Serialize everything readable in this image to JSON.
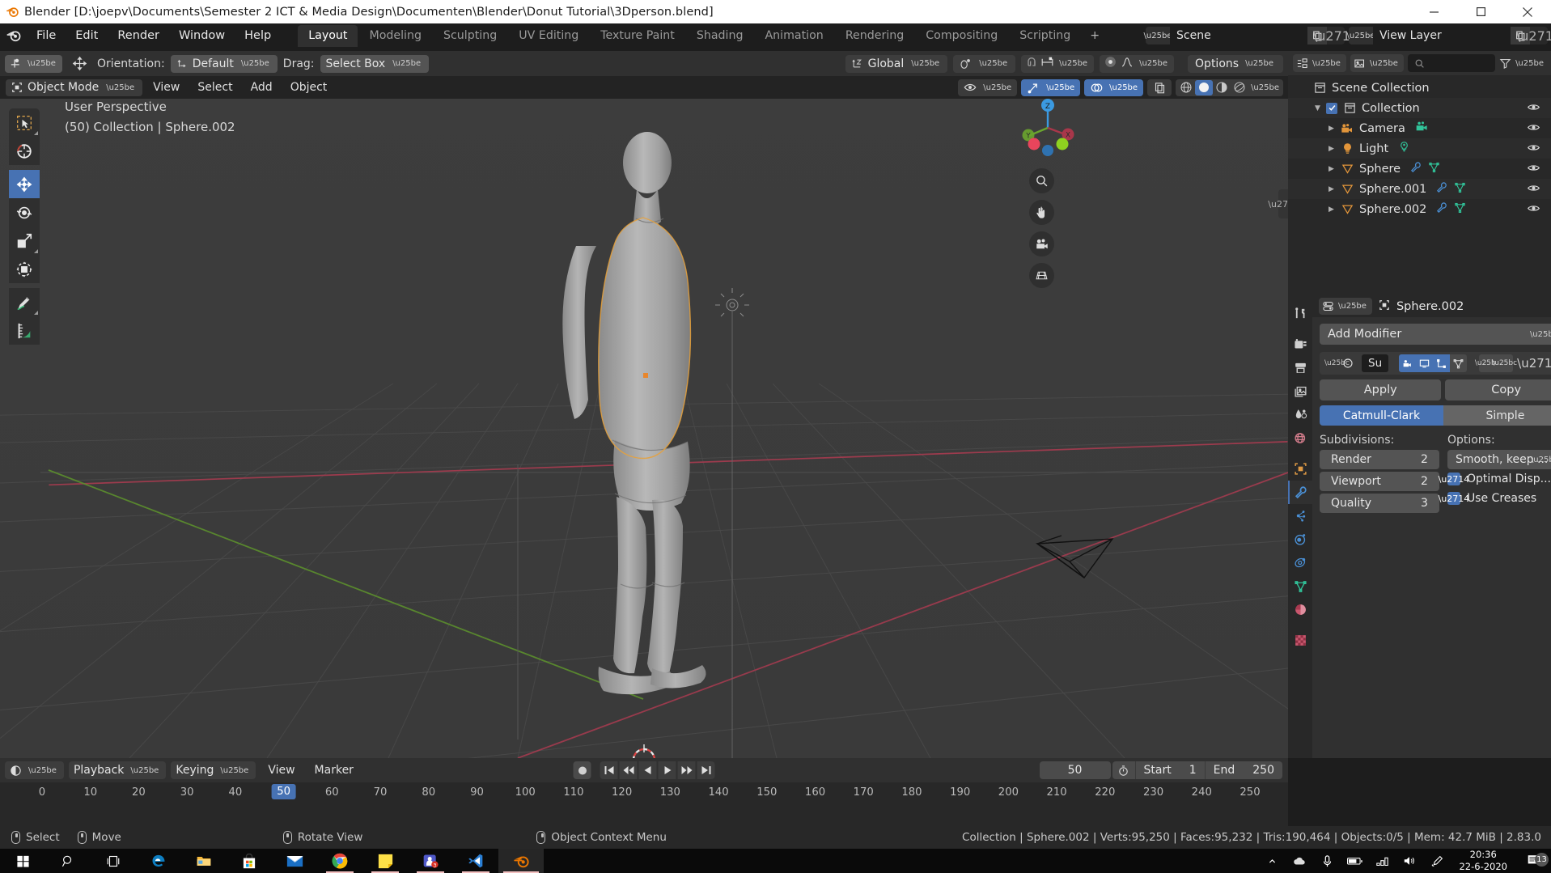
{
  "window": {
    "title": "Blender [D:\\joepv\\Documents\\Semester 2 ICT & Media Design\\Documenten\\Blender\\Donut Tutorial\\3Dperson.blend]",
    "minimize": "–",
    "maximize": "❐",
    "close": "✕"
  },
  "topbar": {
    "menus": [
      "File",
      "Edit",
      "Render",
      "Window",
      "Help"
    ],
    "workspaces": [
      "Layout",
      "Modeling",
      "Sculpting",
      "UV Editing",
      "Texture Paint",
      "Shading",
      "Animation",
      "Rendering",
      "Compositing",
      "Scripting"
    ],
    "active_workspace": "Layout",
    "add_workspace": "+",
    "scene_name": "Scene",
    "view_layer_name": "View Layer"
  },
  "tool_header": {
    "orientation_label": "Orientation:",
    "orientation_value": "Default",
    "drag_label": "Drag:",
    "drag_value": "Select Box",
    "transform_orientation": "Global",
    "options_label": "Options"
  },
  "viewport": {
    "mode": "Object Mode",
    "menus": [
      "View",
      "Select",
      "Add",
      "Object"
    ],
    "perspective_text": "User Perspective",
    "scene_info_text": "(50) Collection | Sphere.002",
    "tools": [
      "tweak-select-tool",
      "cursor-tool",
      "move-tool",
      "rotate-tool",
      "scale-tool",
      "transform-tool",
      "annotate-tool",
      "measure-tool"
    ],
    "gizmo_axes": [
      "Z",
      "Y",
      "X"
    ]
  },
  "outliner": {
    "search_placeholder": "",
    "rows": [
      {
        "name": "Scene Collection",
        "icon": "collection-icon",
        "indent": 0,
        "twisty": "",
        "checkbox": false,
        "extras": [],
        "eye": false
      },
      {
        "name": "Collection",
        "icon": "collection-icon",
        "indent": 1,
        "twisty": "▼",
        "checkbox": true,
        "extras": [],
        "eye": true
      },
      {
        "name": "Camera",
        "icon": "camera-icon",
        "indent": 2,
        "twisty": "▶",
        "checkbox": false,
        "extras": [
          "camera-data-icon"
        ],
        "eye": true
      },
      {
        "name": "Light",
        "icon": "light-icon",
        "indent": 2,
        "twisty": "▶",
        "checkbox": false,
        "extras": [
          "light-data-icon"
        ],
        "eye": true
      },
      {
        "name": "Sphere",
        "icon": "mesh-object-icon",
        "indent": 2,
        "twisty": "▶",
        "checkbox": false,
        "extras": [
          "modifier-icon",
          "mesh-data-icon"
        ],
        "eye": true
      },
      {
        "name": "Sphere.001",
        "icon": "mesh-object-icon",
        "indent": 2,
        "twisty": "▶",
        "checkbox": false,
        "extras": [
          "modifier-icon",
          "mesh-data-icon"
        ],
        "eye": true
      },
      {
        "name": "Sphere.002",
        "icon": "mesh-object-icon",
        "indent": 2,
        "twisty": "▶",
        "checkbox": false,
        "extras": [
          "modifier-icon",
          "mesh-data-icon"
        ],
        "eye": true
      }
    ]
  },
  "properties": {
    "breadcrumb_object": "Sphere.002",
    "tabs": [
      "tool-tab",
      "render-tab",
      "output-tab",
      "view-layer-tab",
      "scene-tab",
      "world-tab",
      "object-tab",
      "modifier-tab",
      "particles-tab",
      "physics-tab",
      "constraints-tab",
      "object-data-tab",
      "material-tab",
      "texture-tab"
    ],
    "active_tab": "modifier-tab",
    "add_modifier_label": "Add Modifier",
    "modifier": {
      "name": "Su",
      "apply_label": "Apply",
      "copy_label": "Copy",
      "type_options": [
        "Catmull-Clark",
        "Simple"
      ],
      "type_selected": "Catmull-Clark",
      "subdivisions_label": "Subdivisions:",
      "options_label": "Options:",
      "fields": [
        {
          "label": "Render",
          "value": "2"
        },
        {
          "label": "Viewport",
          "value": "2"
        },
        {
          "label": "Quality",
          "value": "3"
        }
      ],
      "uv_smooth": "Smooth, keep ...",
      "checkboxes": [
        {
          "label": "Optimal Disp...",
          "checked": true
        },
        {
          "label": "Use Creases",
          "checked": true
        }
      ]
    }
  },
  "timeline": {
    "menus_dropdown": [
      "Playback",
      "Keying"
    ],
    "menus_plain": [
      "View",
      "Marker"
    ],
    "current_frame": "50",
    "start_label": "Start",
    "start_value": "1",
    "end_label": "End",
    "end_value": "250",
    "ticks": [
      "0",
      "10",
      "20",
      "30",
      "40",
      "50",
      "60",
      "70",
      "80",
      "90",
      "100",
      "110",
      "120",
      "130",
      "140",
      "150",
      "160",
      "170",
      "180",
      "190",
      "200",
      "210",
      "220",
      "230",
      "240",
      "250"
    ],
    "playhead_frame": "50"
  },
  "statusbar": {
    "hints": [
      {
        "mouse": "left",
        "label": "Select"
      },
      {
        "mouse": "drag",
        "label": "Move"
      },
      {
        "mouse": "middle",
        "label": "Rotate View"
      },
      {
        "mouse": "right",
        "label": "Object Context Menu"
      }
    ],
    "info": "Collection | Sphere.002 | Verts:95,250 | Faces:95,232 | Tris:190,464 | Objects:0/5 | Mem: 42.7 MiB | 2.83.0"
  },
  "taskbar": {
    "items": [
      "start-icon",
      "search-icon",
      "task-view-icon",
      "edge-icon",
      "file-explorer-icon",
      "microsoft-store-icon",
      "mail-icon",
      "chrome-icon",
      "sticky-notes-icon",
      "teams-icon",
      "vscode-icon",
      "blender-icon"
    ],
    "tray": [
      "hidden-icons-icon",
      "cloud-icon",
      "microphone-icon",
      "battery-icon",
      "network-icon",
      "volume-icon",
      "pen-icon"
    ],
    "time": "20:36",
    "date": "22-6-2020",
    "notification_count": "13"
  },
  "colors": {
    "accent_blue": "#4772b3",
    "orange": "#e8862c",
    "green": "#3bd68a",
    "grid": "#4a4a4a",
    "x_axis": "#a33b4f",
    "y_axis": "#5c8f2d"
  }
}
